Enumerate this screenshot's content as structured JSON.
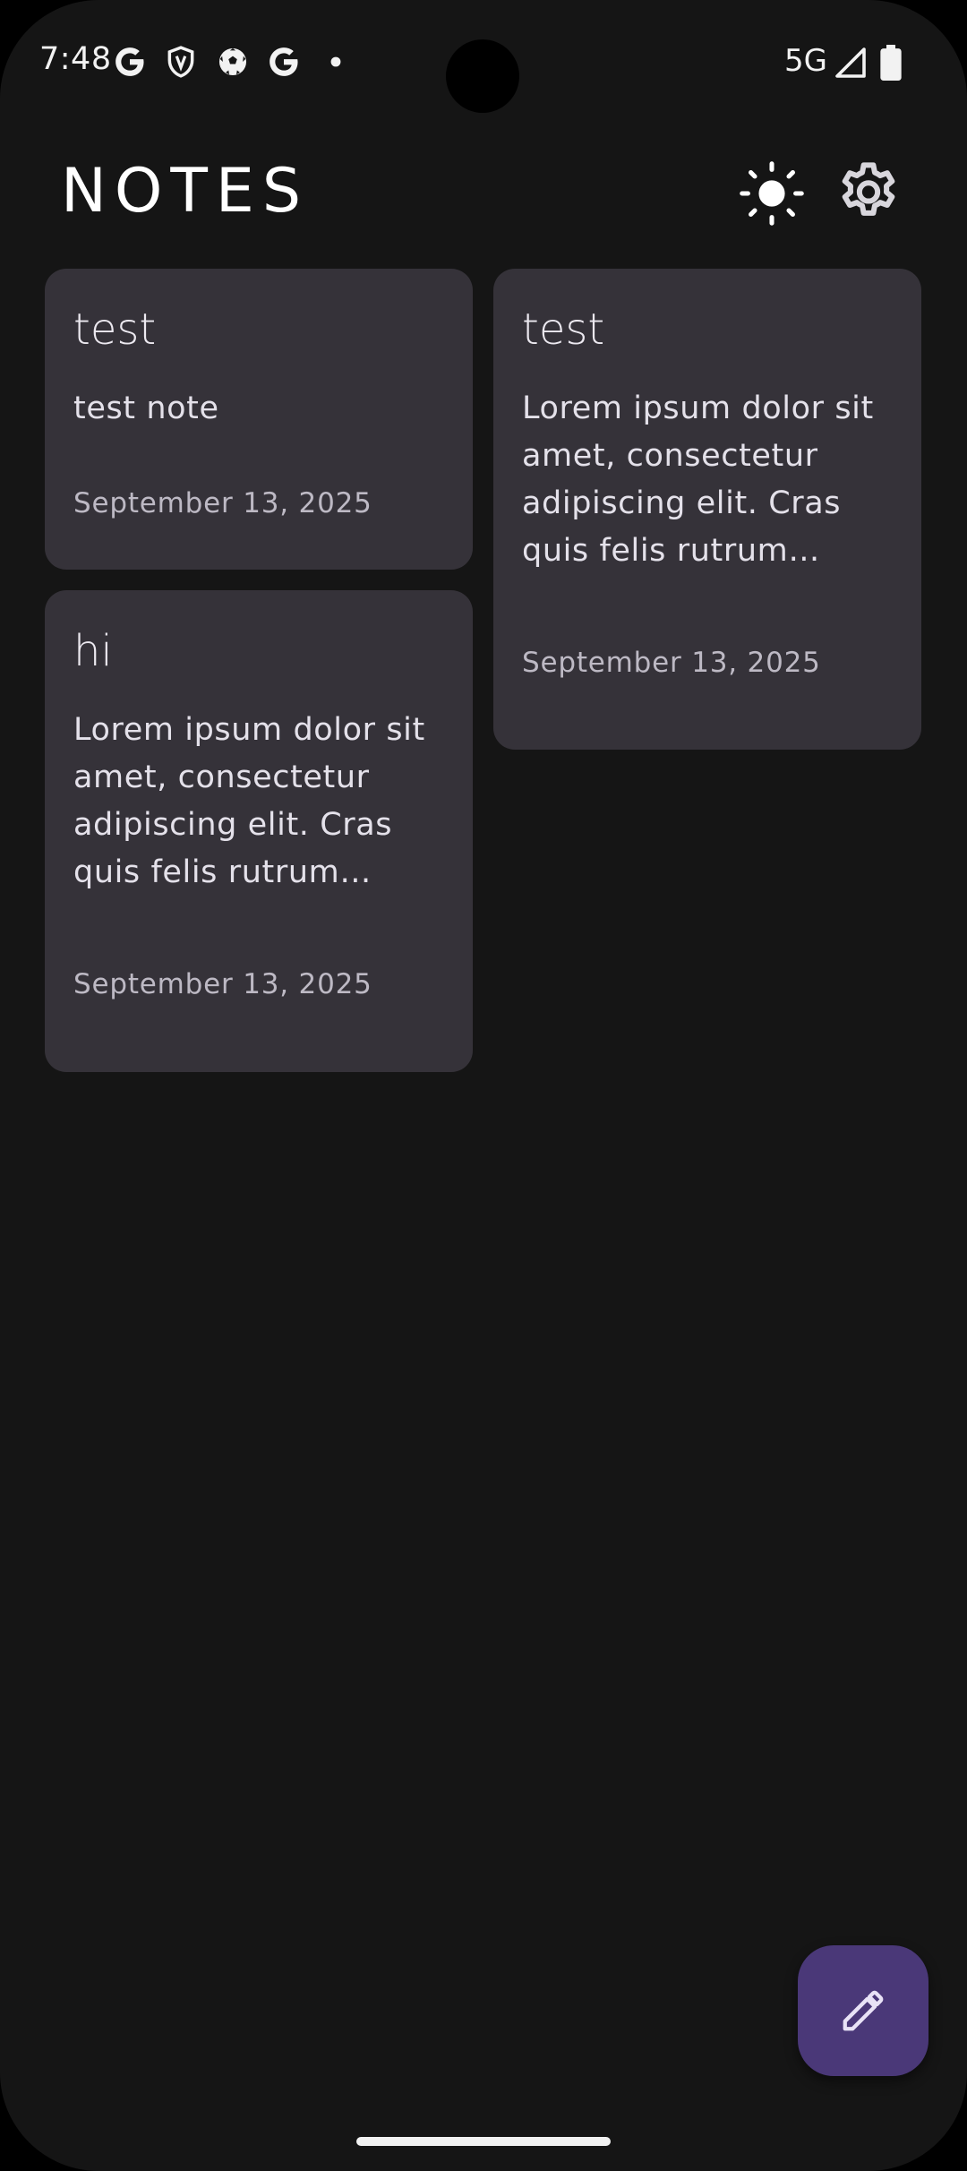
{
  "status_bar": {
    "time": "7:48",
    "network": "5G",
    "icons": [
      "google-g-icon",
      "vpn-shield-icon",
      "soccer-ball-icon",
      "google-g-icon",
      "notification-dot-icon",
      "cell-signal-icon",
      "battery-icon"
    ]
  },
  "header": {
    "title": "NOTES",
    "theme_toggle_icon": "sun-icon",
    "settings_icon": "gear-icon"
  },
  "notes": [
    {
      "title": "test",
      "body": "test note",
      "date": "September 13, 2025"
    },
    {
      "title": "test",
      "body": "Lorem ipsum dolor sit amet, consectetur adipiscing elit. Cras quis felis rutrum diam…",
      "date": "September 13, 2025"
    },
    {
      "title": "hi",
      "body": "Lorem ipsum dolor sit amet, consectetur adipiscing elit. Cras quis felis rutrum diam…",
      "date": "September 13, 2025"
    }
  ],
  "fab": {
    "icon": "pencil-icon"
  },
  "colors": {
    "background": "#151515",
    "card": "#353239",
    "fab": "#4a3878",
    "text": "#e8e6ec",
    "date_text": "#bdb9c4"
  }
}
